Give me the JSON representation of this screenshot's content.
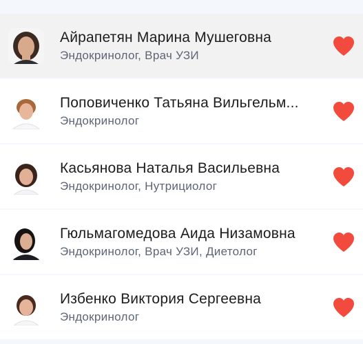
{
  "doctors": [
    {
      "name": "Айрапетян Марина Мушеговна",
      "specialty": "Эндокринолог, Врач УЗИ",
      "favorite": true,
      "highlighted": true,
      "avatar": "doctor-photo"
    },
    {
      "name": "Поповиченко Татьяна Вильгельм...",
      "specialty": "Эндокринолог",
      "favorite": true,
      "highlighted": false,
      "avatar": "doctor-photo"
    },
    {
      "name": "Касьянова Наталья Васильевна",
      "specialty": "Эндокринолог, Нутрициолог",
      "favorite": true,
      "highlighted": false,
      "avatar": "doctor-photo"
    },
    {
      "name": "Гюльмагомедова Аида Низамовна",
      "specialty": "Эндокринолог, Врач УЗИ, Диетолог",
      "favorite": true,
      "highlighted": false,
      "avatar": "doctor-photo"
    },
    {
      "name": "Избенко Виктория Сергеевна",
      "specialty": "Эндокринолог",
      "favorite": true,
      "highlighted": false,
      "avatar": "doctor-photo"
    }
  ],
  "colors": {
    "heart": "#f24a3c",
    "background": "#f4f7fb",
    "highlight": "#f2f2f2",
    "name_text": "#1c1c1e",
    "specialty_text": "#5b6573"
  },
  "icons": {
    "favorite": "heart-icon"
  }
}
